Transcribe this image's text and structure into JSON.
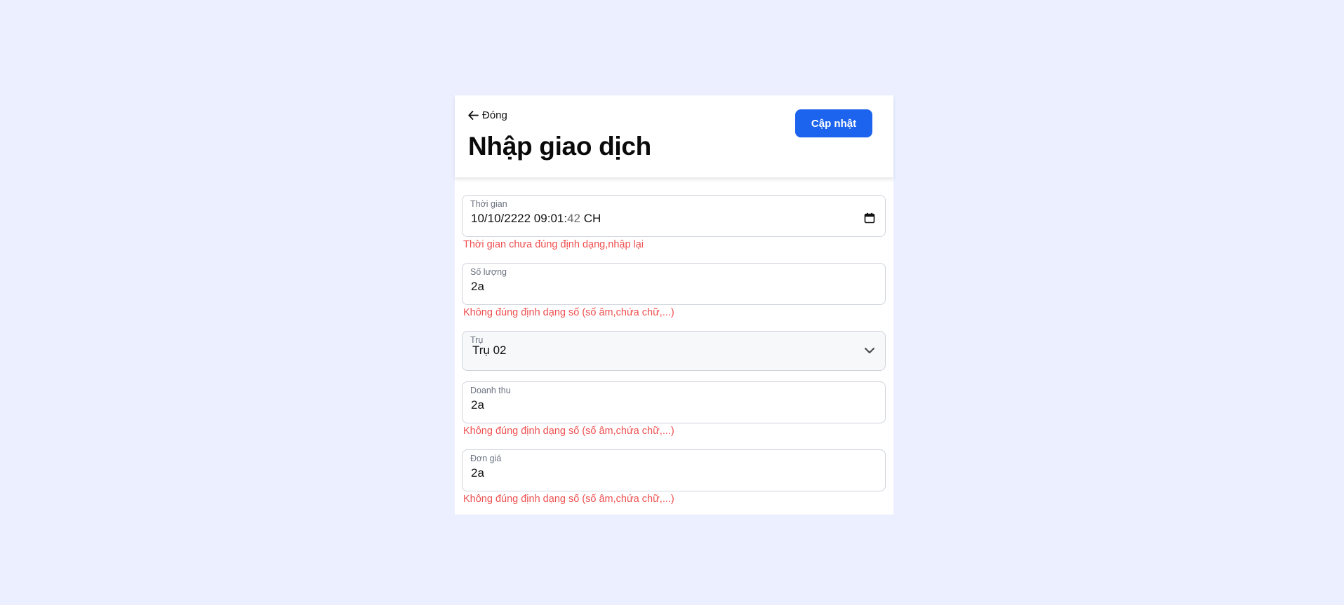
{
  "header": {
    "back_label": "Đóng",
    "title": "Nhập giao dịch",
    "update_label": "Cập nhật"
  },
  "form": {
    "time": {
      "label": "Thời gian",
      "value_main": "10/10/2222 09:01:",
      "value_seconds": "42",
      "value_period": " CH",
      "error": "Thời gian chưa đúng định dạng,nhập lại"
    },
    "quantity": {
      "label": "Số lượng",
      "value": "2a",
      "error": "Không đúng định dạng số (số âm,chứa chữ,...)"
    },
    "pump": {
      "label": "Trụ",
      "value": "Trụ 02"
    },
    "revenue": {
      "label": "Doanh thu",
      "value": "2a",
      "error": "Không đúng định dạng số (số âm,chứa chữ,...)"
    },
    "unit_price": {
      "label": "Đơn giá",
      "value": "2a",
      "error": "Không đúng định dạng số (số âm,chứa chữ,...)"
    }
  },
  "colors": {
    "background": "#ecefff",
    "accent": "#1c63ee",
    "error": "#ef4f4f"
  },
  "icons": {
    "back": "arrow-left-icon",
    "calendar": "calendar-icon",
    "select": "chevron-down-icon"
  }
}
